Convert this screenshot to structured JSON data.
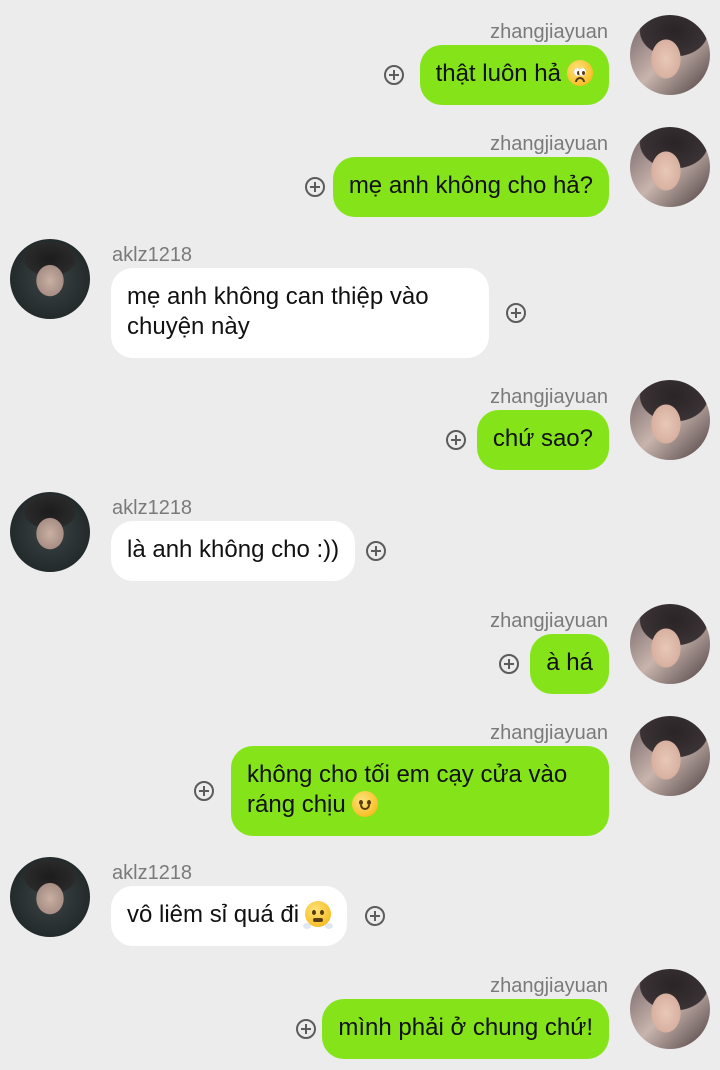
{
  "chat": {
    "messages": [
      {
        "direction": "sent",
        "user": "zhangjiayuan",
        "text": "thật luôn hả",
        "emoji": "pleading-face-emoji"
      },
      {
        "direction": "sent",
        "user": "zhangjiayuan",
        "text": "mẹ anh không cho hả?"
      },
      {
        "direction": "received",
        "user": "aklz1218",
        "text": "mẹ anh không can thiệp vào chuyện này"
      },
      {
        "direction": "sent",
        "user": "zhangjiayuan",
        "text": "chứ sao?"
      },
      {
        "direction": "received",
        "user": "aklz1218",
        "text": "là anh không cho :))"
      },
      {
        "direction": "sent",
        "user": "zhangjiayuan",
        "text": "à há"
      },
      {
        "direction": "sent",
        "user": "zhangjiayuan",
        "text_line1": "không cho tối em cạy cửa vào",
        "text_line2": "ráng chịu",
        "emoji": "smiling-face-emoji"
      },
      {
        "direction": "received",
        "user": "aklz1218",
        "text": "vô liêm sỉ quá đi",
        "emoji": "face-with-steam-emoji"
      },
      {
        "direction": "sent",
        "user": "zhangjiayuan",
        "text": "mình phải ở chung chứ!"
      }
    ]
  },
  "colors": {
    "background": "#ececec",
    "sent_bubble": "#85e31a",
    "received_bubble": "#ffffff",
    "username": "#7a7a7a"
  }
}
